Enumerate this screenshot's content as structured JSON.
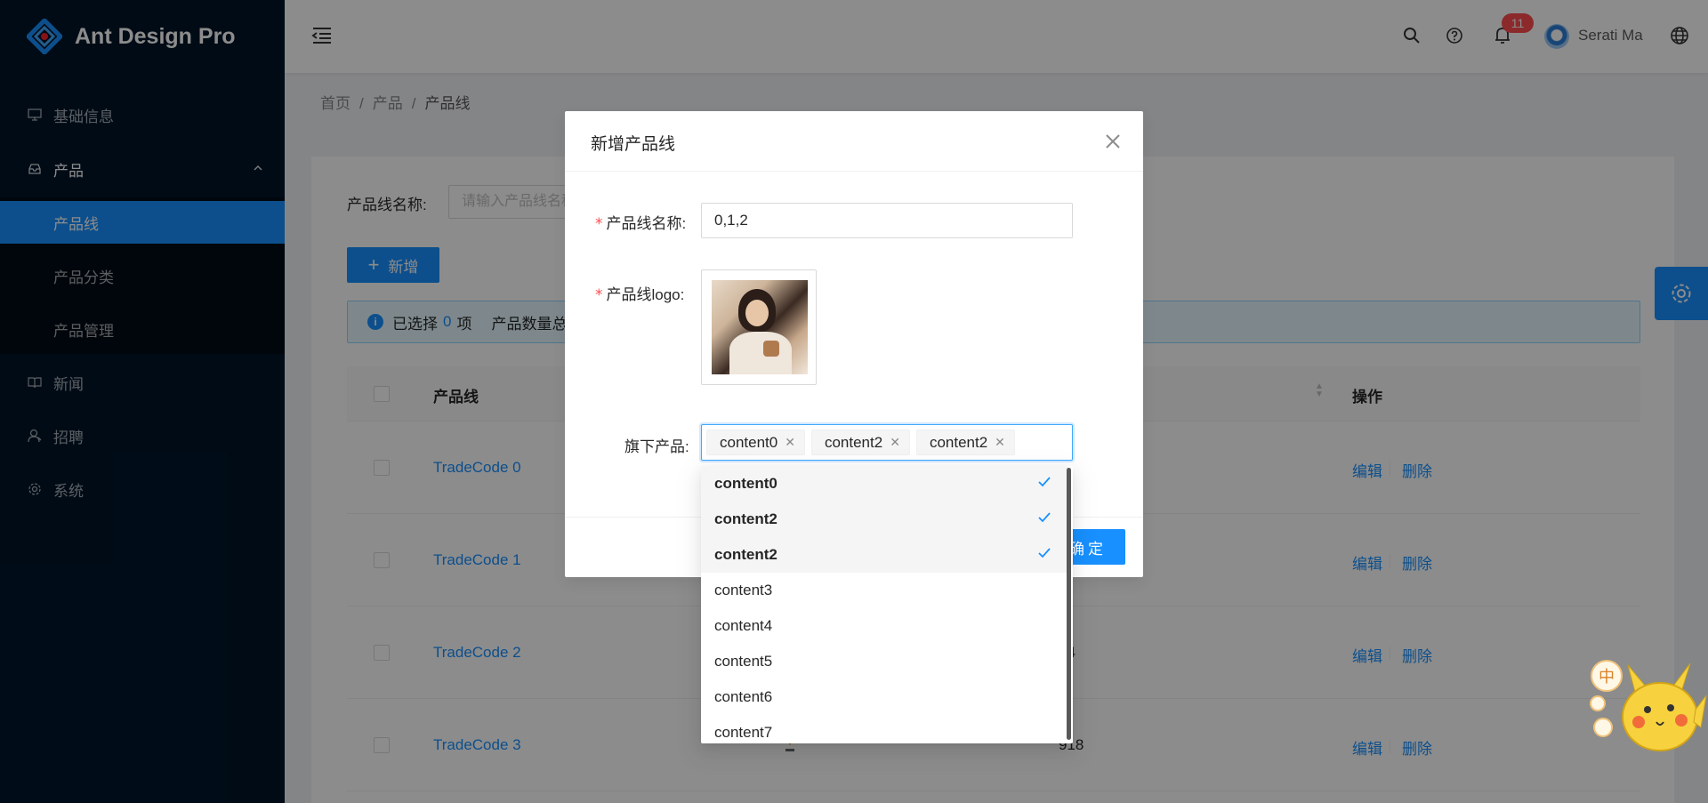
{
  "app": {
    "title": "Ant Design Pro"
  },
  "sidebar": {
    "items": [
      {
        "label": "基础信息",
        "icon": "desktop-icon"
      },
      {
        "label": "产品",
        "icon": "inbox-icon"
      },
      {
        "label": "新闻",
        "icon": "read-icon"
      },
      {
        "label": "招聘",
        "icon": "user-icon"
      },
      {
        "label": "系统",
        "icon": "setting-icon"
      }
    ],
    "submenu": [
      {
        "label": "产品线",
        "active": true
      },
      {
        "label": "产品分类"
      },
      {
        "label": "产品管理"
      }
    ]
  },
  "header": {
    "notifications": "11",
    "user_name": "Serati Ma"
  },
  "breadcrumb": [
    "首页",
    "产品",
    "产品线"
  ],
  "filter": {
    "label": "产品线名称:",
    "placeholder": "请输入产品线名称"
  },
  "toolbar": {
    "new_label": "新增"
  },
  "alert": {
    "selected_prefix": "已选择",
    "selected_count": "0",
    "selected_suffix": "项",
    "total_label": "产品数量总"
  },
  "table": {
    "columns": [
      "产品线",
      "操作"
    ],
    "rows": [
      {
        "name": "TradeCode 0",
        "count": ""
      },
      {
        "name": "TradeCode 1",
        "count": ""
      },
      {
        "name": "TradeCode 2",
        "count": "34"
      },
      {
        "name": "TradeCode 3",
        "count": "918"
      }
    ],
    "edit_label": "编辑",
    "delete_label": "删除"
  },
  "modal": {
    "title": "新增产品线",
    "name_label": "产品线名称:",
    "name_value": "0,1,2",
    "logo_label": "产品线logo:",
    "products_label": "旗下产品:",
    "tags": [
      "content0",
      "content2",
      "content2"
    ],
    "ok_label": "确定"
  },
  "dropdown": {
    "options": [
      {
        "label": "content0",
        "selected": true
      },
      {
        "label": "content2",
        "selected": true
      },
      {
        "label": "content2",
        "selected": true
      },
      {
        "label": "content3",
        "selected": false
      },
      {
        "label": "content4",
        "selected": false
      },
      {
        "label": "content5",
        "selected": false
      },
      {
        "label": "content6",
        "selected": false
      },
      {
        "label": "content7",
        "selected": false
      }
    ]
  },
  "mascot": {
    "badge_text": "中"
  },
  "colors": {
    "primary": "#1890ff",
    "sider": "#001529",
    "danger": "#ff4d4f"
  }
}
